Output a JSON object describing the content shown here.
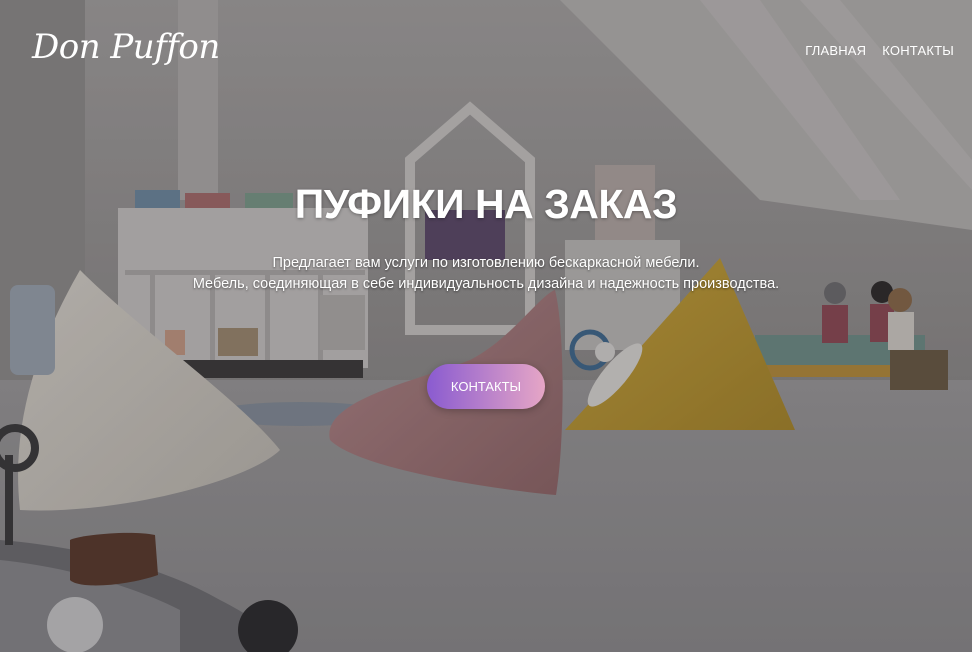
{
  "header": {
    "logo_text": "Don Puffon",
    "nav": [
      {
        "label": "ГЛАВНАЯ"
      },
      {
        "label": "КОНТАКТЫ"
      }
    ]
  },
  "hero": {
    "title": "ПУФИКИ НА ЗАКАЗ",
    "subtitle_line1": "Предлагает вам услуги по изготовлению бескаркасной мебели.",
    "subtitle_line2": "Мебель, соединяющая в себе индивидуальность дизайна и надежность производства.",
    "cta_label": "КОНТАКТЫ"
  },
  "colors": {
    "cta_gradient_start": "#8a5bd0",
    "cta_gradient_end": "#e6a6c6",
    "text": "#ffffff"
  }
}
